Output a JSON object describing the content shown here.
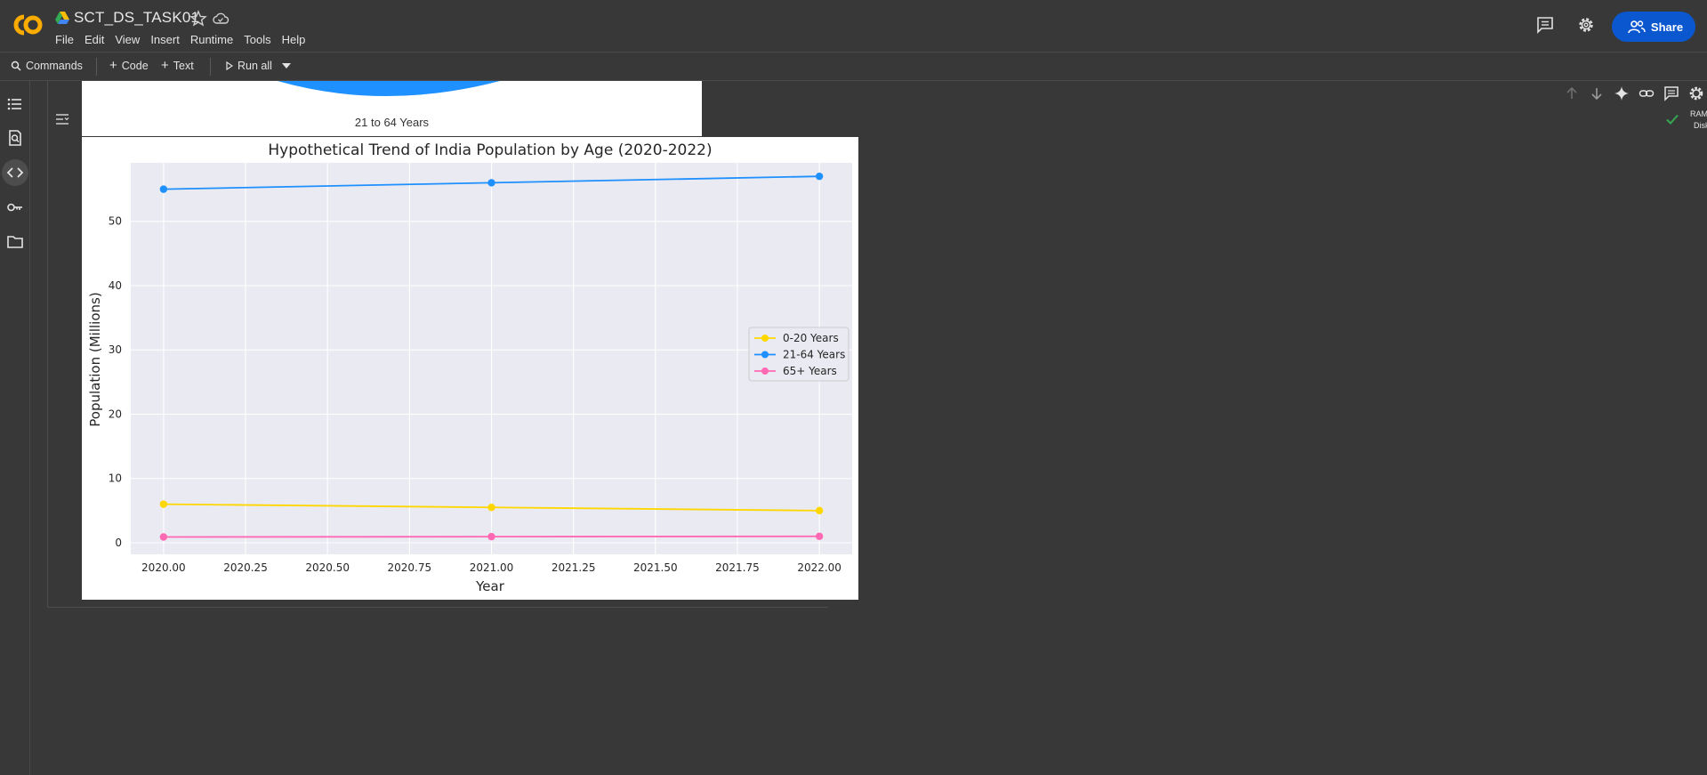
{
  "app": {
    "title": "SCT_DS_TASK01",
    "menu": [
      "File",
      "Edit",
      "View",
      "Insert",
      "Runtime",
      "Tools",
      "Help"
    ],
    "share_label": "Share",
    "brand_color": "#f9ab00"
  },
  "toolbar": {
    "commands_label": "Commands",
    "code_label": "Code",
    "text_label": "Text",
    "run_all_label": "Run all",
    "ram_label": "RAM",
    "disk_label": "Disk"
  },
  "previous_output": {
    "pie_label": "21 to 64 Years",
    "pie_color": "#1e90ff"
  },
  "chart_data": {
    "type": "line",
    "title": "Hypothetical Trend of India Population by Age (2020-2022)",
    "xlabel": "Year",
    "ylabel": "Population (Millions)",
    "x": [
      2020,
      2021,
      2022
    ],
    "xticks": [
      "2020.00",
      "2020.25",
      "2020.50",
      "2020.75",
      "2021.00",
      "2021.25",
      "2021.50",
      "2021.75",
      "2022.00"
    ],
    "yticks": [
      "0",
      "10",
      "20",
      "30",
      "40",
      "50"
    ],
    "xlim": [
      2019.9,
      2022.1
    ],
    "ylim": [
      -1.8,
      59.1
    ],
    "grid": true,
    "legend_position": "center-right",
    "series": [
      {
        "name": "0-20 Years",
        "values": [
          6,
          5.5,
          5
        ],
        "color": "#ffd700"
      },
      {
        "name": "21-64 Years",
        "values": [
          55,
          56,
          57
        ],
        "color": "#1e90ff"
      },
      {
        "name": "65+ Years",
        "values": [
          0.9,
          0.95,
          1.0
        ],
        "color": "#ff69b4"
      }
    ]
  }
}
